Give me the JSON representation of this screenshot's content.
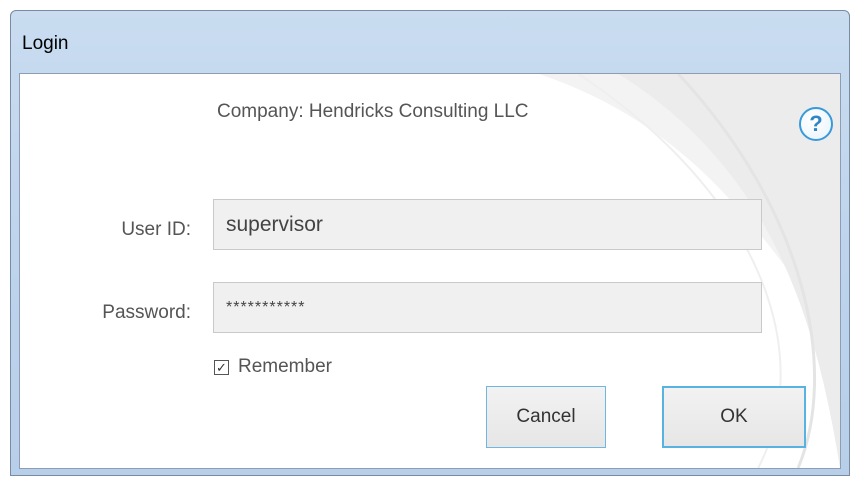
{
  "window": {
    "title": "Login"
  },
  "dialog": {
    "company": "Company: Hendricks Consulting LLC",
    "help_glyph": "?"
  },
  "form": {
    "user_id_label": "User ID:",
    "user_id_value": "supervisor",
    "password_label": "Password:",
    "password_value": "***********",
    "remember_label": "Remember",
    "remember_checked": true,
    "remember_glyph": "✓"
  },
  "buttons": {
    "cancel_label": "Cancel",
    "ok_label": "OK"
  },
  "icons": {
    "help": "help-icon",
    "check": "checkmark-icon"
  },
  "colors": {
    "titlebar": "#bcd3ec",
    "button_focus_border": "#58b3e0",
    "help_icon": "#2f86c6"
  }
}
